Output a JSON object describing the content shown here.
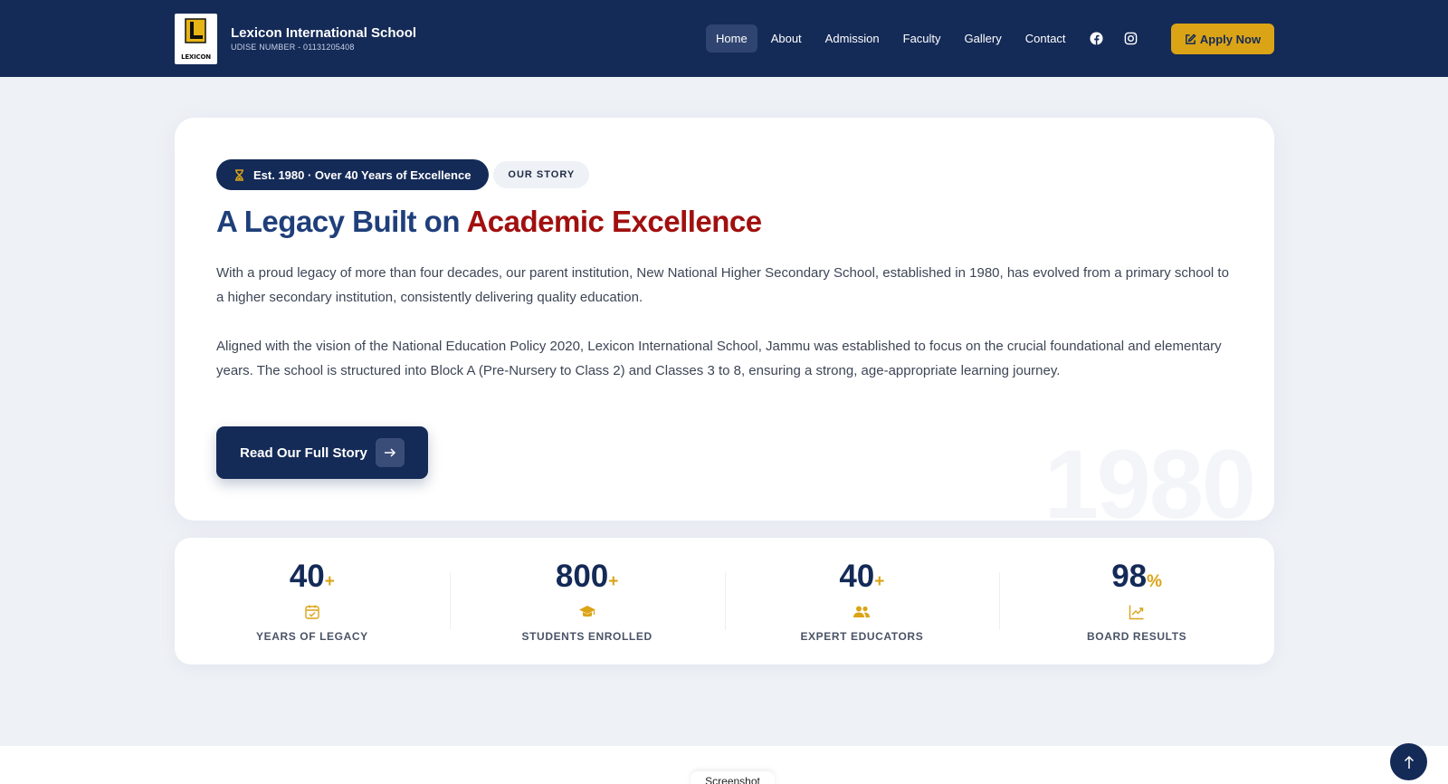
{
  "brand": {
    "name": "Lexicon International School",
    "udise": "UDISE NUMBER - 01131205408",
    "logo_text": "LEXICON"
  },
  "nav": {
    "items": [
      {
        "label": "Home",
        "active": true
      },
      {
        "label": "About",
        "active": false
      },
      {
        "label": "Admission",
        "active": false
      },
      {
        "label": "Faculty",
        "active": false
      },
      {
        "label": "Gallery",
        "active": false
      },
      {
        "label": "Contact",
        "active": false
      }
    ],
    "social_icons": [
      "facebook-icon",
      "instagram-icon"
    ],
    "apply_label": "Apply Now"
  },
  "story": {
    "badge": "Est. 1980 · Over 40 Years of Excellence",
    "tag": "OUR STORY",
    "headline_part1": "A Legacy Built on",
    "headline_part2": "Academic Excellence",
    "paragraph1": "With a proud legacy of more than four decades, our parent institution, New National Higher Secondary School, established in 1980, has evolved from a primary school to a higher secondary institution, consistently delivering quality education.",
    "paragraph2": "Aligned with the vision of the National Education Policy 2020, Lexicon International School, Jammu was established to focus on the crucial foundational and elementary years. The school is structured into Block A (Pre-Nursery to Class 2) and Classes 3 to 8, ensuring a strong, age-appropriate learning journey.",
    "cta_label": "Read Our Full Story",
    "watermark": "1980"
  },
  "stats": [
    {
      "value": "40",
      "suffix": "+",
      "label": "YEARS OF LEGACY",
      "icon": "calendar-check-icon"
    },
    {
      "value": "800",
      "suffix": "+",
      "label": "STUDENTS ENROLLED",
      "icon": "graduation-cap-icon"
    },
    {
      "value": "40",
      "suffix": "+",
      "label": "EXPERT EDUCATORS",
      "icon": "users-icon"
    },
    {
      "value": "98",
      "suffix": "%",
      "label": "BOARD RESULTS",
      "icon": "chart-line-icon"
    }
  ],
  "footer": {
    "screenshot_tab": "Screenshot"
  },
  "colors": {
    "navy": "#142a57",
    "gold": "#dba417",
    "red": "#a10f0f",
    "headline_blue": "#1f3f7a",
    "background": "#eef1f6"
  }
}
